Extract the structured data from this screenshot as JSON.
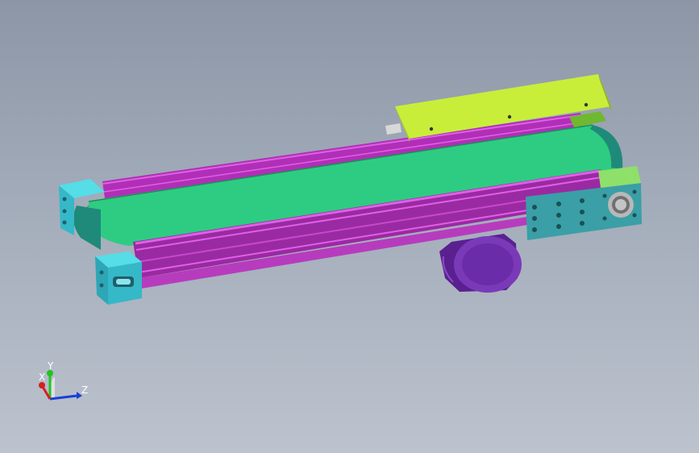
{
  "viewport": {
    "background_top": "#8c96a6",
    "background_bottom": "#bcc3ce"
  },
  "model": {
    "colors": {
      "belt": "#2ecc82",
      "rail": "#b02fb6",
      "rail_highlight": "#e060e8",
      "end_block": "#35b8c8",
      "end_block_light": "#55dde8",
      "motor": "#7a3ab8",
      "motor_dark": "#5a2090",
      "cover": "#c8ee3a",
      "side_plate": "#3a9fa6"
    }
  },
  "triad": {
    "x_label": "X",
    "y_label": "Y",
    "z_label": "Z",
    "x_color": "#d42020",
    "y_color": "#22c422",
    "z_color": "#1a3fd8"
  }
}
